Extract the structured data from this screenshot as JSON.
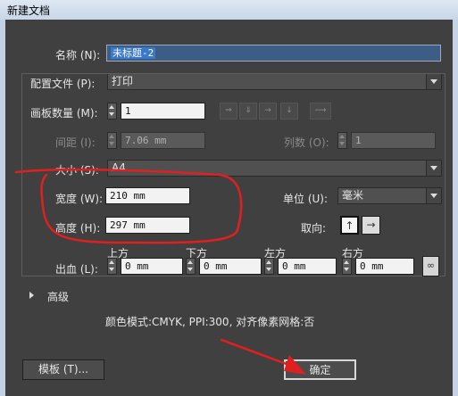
{
  "window": {
    "title": "新建文档"
  },
  "name": {
    "label": "名称 (N):",
    "value": "未标题-2"
  },
  "profile": {
    "label": "配置文件 (P):",
    "value": "打印"
  },
  "artboards": {
    "count_label": "画板数量 (M):",
    "count_value": "1",
    "arrange_icons": [
      "grid-by-row-icon",
      "grid-by-column-icon",
      "arrange-by-row-icon",
      "arrange-by-column-icon",
      "right-to-left-icon"
    ],
    "spacing_label": "间距 (I):",
    "spacing_value": "7.06 mm",
    "columns_label": "列数 (O):",
    "columns_value": "1"
  },
  "size": {
    "label": "大小 (S):",
    "value": "A4"
  },
  "width": {
    "label": "宽度 (W):",
    "value": "210 mm"
  },
  "height": {
    "label": "高度 (H):",
    "value": "297 mm"
  },
  "units": {
    "label": "单位 (U):",
    "value": "毫米"
  },
  "orientation": {
    "label": "取向:",
    "portrait_glyph": "↑",
    "landscape_glyph": "→",
    "selected": "portrait"
  },
  "bleed": {
    "label": "出血 (L):",
    "top_label": "上方",
    "top_value": "0 mm",
    "bottom_label": "下方",
    "bottom_value": "0 mm",
    "left_label": "左方",
    "left_value": "0 mm",
    "right_label": "右方",
    "right_value": "0 mm",
    "link_icon": "∞"
  },
  "advanced": {
    "label": "高级"
  },
  "summary": "颜色模式:CMYK, PPI:300, 对齐像素网格:否",
  "buttons": {
    "templates": "模板 (T)...",
    "ok": "确定"
  },
  "annotation_color": "#e02020"
}
